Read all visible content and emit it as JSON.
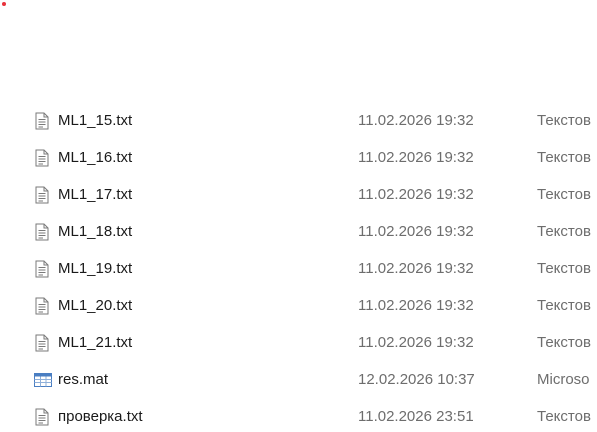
{
  "files": [
    {
      "name": "ML1_15.txt",
      "modified": "11.02.2026 19:32",
      "type": "Текстов",
      "icon": "text-file-icon"
    },
    {
      "name": "ML1_16.txt",
      "modified": "11.02.2026 19:32",
      "type": "Текстов",
      "icon": "text-file-icon"
    },
    {
      "name": "ML1_17.txt",
      "modified": "11.02.2026 19:32",
      "type": "Текстов",
      "icon": "text-file-icon"
    },
    {
      "name": "ML1_18.txt",
      "modified": "11.02.2026 19:32",
      "type": "Текстов",
      "icon": "text-file-icon"
    },
    {
      "name": "ML1_19.txt",
      "modified": "11.02.2026 19:32",
      "type": "Текстов",
      "icon": "text-file-icon"
    },
    {
      "name": "ML1_20.txt",
      "modified": "11.02.2026 19:32",
      "type": "Текстов",
      "icon": "text-file-icon"
    },
    {
      "name": "ML1_21.txt",
      "modified": "11.02.2026 19:32",
      "type": "Текстов",
      "icon": "text-file-icon"
    },
    {
      "name": "res.mat",
      "modified": "12.02.2026 10:37",
      "type": "Microso",
      "icon": "table-file-icon"
    },
    {
      "name": "проверка.txt",
      "modified": "11.02.2026 23:51",
      "type": "Текстов",
      "icon": "text-file-icon"
    }
  ],
  "colors": {
    "text": "#1a1a1a",
    "secondary_text": "#6d6d6d",
    "indicator": "#e8323c"
  }
}
